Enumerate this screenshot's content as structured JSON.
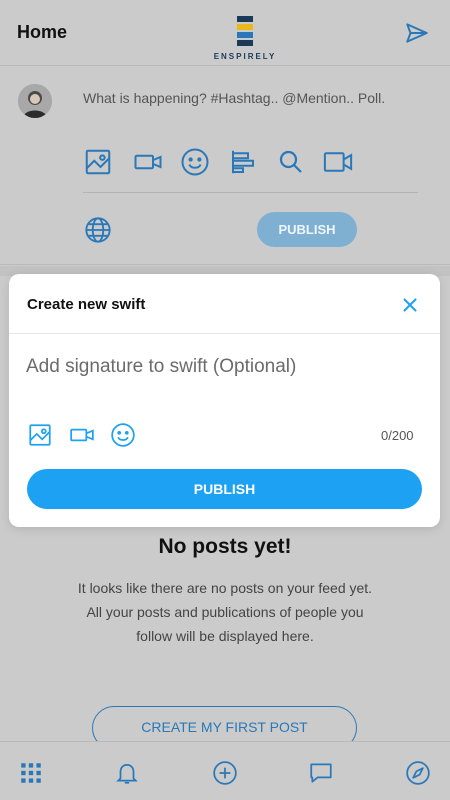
{
  "header": {
    "title": "Home",
    "logo_text": "ENSPIRELY",
    "send_icon": "send-icon"
  },
  "composer": {
    "placeholder": "What is happening? #Hashtag.. @Mention.. Poll.",
    "tools": [
      "image-icon",
      "video-icon",
      "emoji-icon",
      "poll-icon",
      "search-icon",
      "video-camera-icon"
    ],
    "privacy_icon": "globe-icon",
    "publish_label": "PUBLISH"
  },
  "modal": {
    "title": "Create new swift",
    "close_icon": "close-icon",
    "input_placeholder": "Add signature to swift (Optional)",
    "tools": [
      "image-icon",
      "video-icon",
      "emoji-icon"
    ],
    "char_count": "0/200",
    "publish_label": "PUBLISH"
  },
  "empty_state": {
    "title": "No posts yet!",
    "line1": "It looks like there are no posts on your feed yet.",
    "line2": "All your posts and publications of people you",
    "line3": "follow will be displayed here.",
    "cta_label": "CREATE MY FIRST POST"
  },
  "bottom_nav": [
    "apps-grid-icon",
    "bell-icon",
    "plus-circle-icon",
    "chat-icon",
    "compass-icon"
  ],
  "colors": {
    "accent": "#1da1f2",
    "icon_blue": "#2a78b8",
    "overlay_bg": "#cbcbcb",
    "disabled_publish": "#7fb0d2"
  }
}
